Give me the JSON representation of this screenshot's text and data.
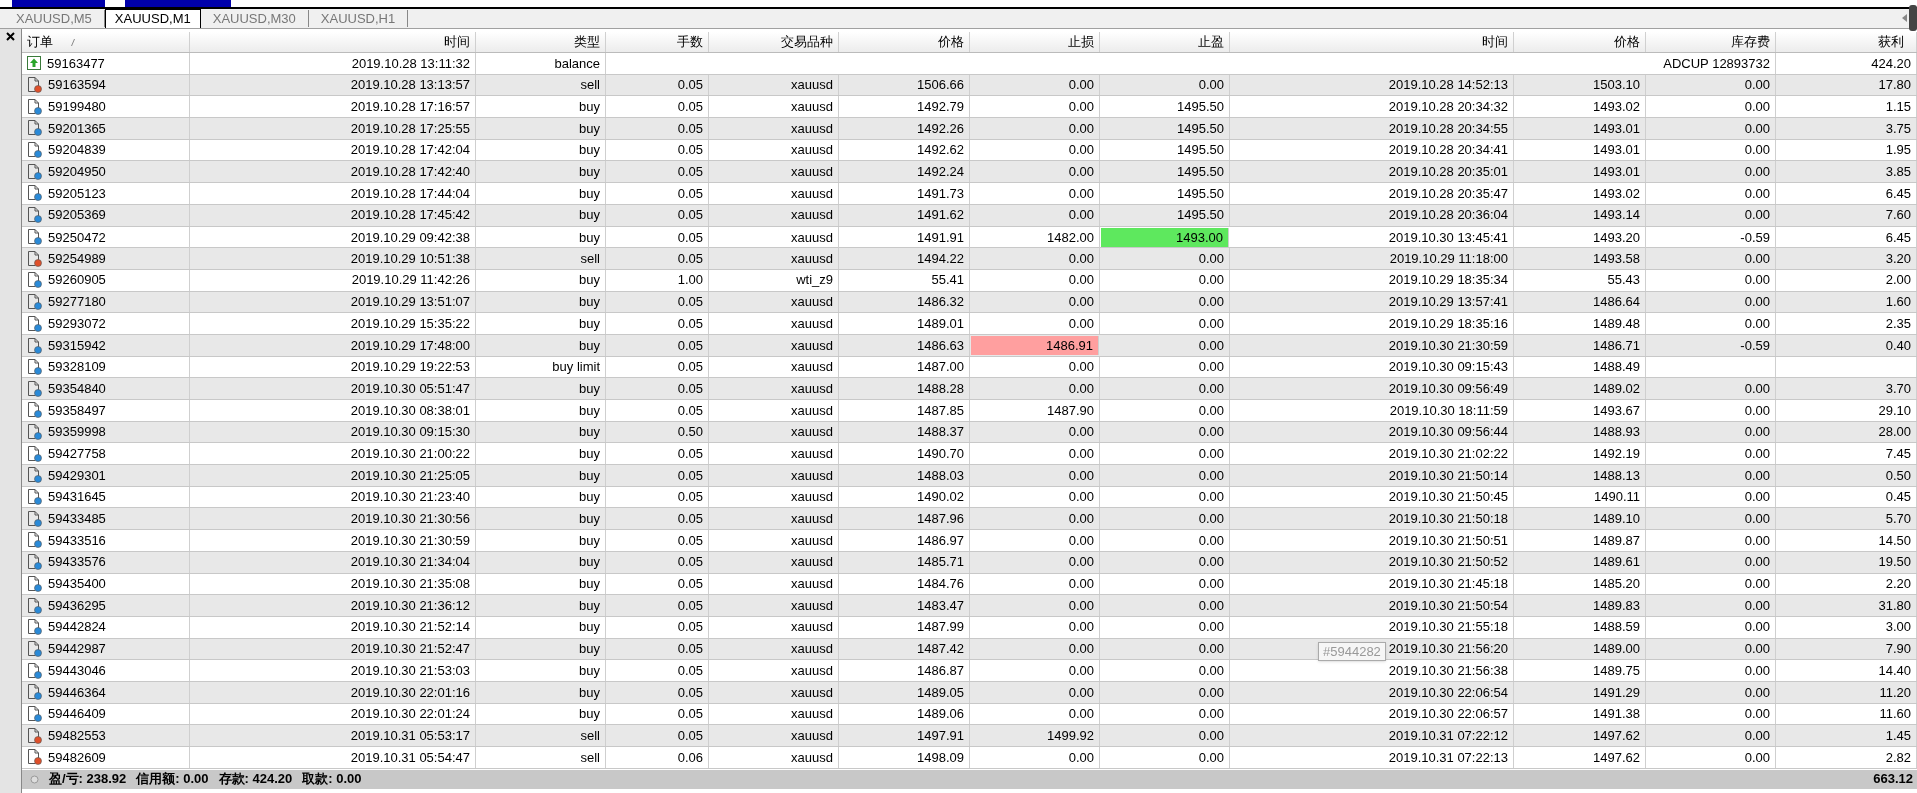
{
  "tabs": [
    {
      "label": "XAUUSD,M5",
      "selected": false
    },
    {
      "label": "XAUUSD,M1",
      "selected": true
    },
    {
      "label": "XAUUSD,M30",
      "selected": false
    },
    {
      "label": "XAUUSD,H1",
      "selected": false
    }
  ],
  "table": {
    "columns": [
      "订单",
      "时间",
      "类型",
      "手数",
      "交易品种",
      "价格",
      "止损",
      "止盈",
      "时间",
      "价格",
      "库存费",
      "获利"
    ],
    "rows": [
      {
        "kind": "balance",
        "order": "59163477",
        "time": "2019.10.28 13:11:32",
        "type": "balance",
        "comment": "ADCUP 12893732",
        "profit": "424.20"
      },
      {
        "kind": "sell",
        "order": "59163594",
        "time": "2019.10.28 13:13:57",
        "type": "sell",
        "volume": "0.05",
        "symbol": "xauusd",
        "price": "1506.66",
        "sl": "0.00",
        "tp": "0.00",
        "sl_hit": false,
        "tp_hit": false,
        "close_time": "2019.10.28 14:52:13",
        "close_price": "1503.10",
        "swap": "0.00",
        "profit": "17.80"
      },
      {
        "kind": "buy",
        "order": "59199480",
        "time": "2019.10.28 17:16:57",
        "type": "buy",
        "volume": "0.05",
        "symbol": "xauusd",
        "price": "1492.79",
        "sl": "0.00",
        "tp": "1495.50",
        "sl_hit": false,
        "tp_hit": false,
        "close_time": "2019.10.28 20:34:32",
        "close_price": "1493.02",
        "swap": "0.00",
        "profit": "1.15"
      },
      {
        "kind": "buy",
        "order": "59201365",
        "time": "2019.10.28 17:25:55",
        "type": "buy",
        "volume": "0.05",
        "symbol": "xauusd",
        "price": "1492.26",
        "sl": "0.00",
        "tp": "1495.50",
        "sl_hit": false,
        "tp_hit": false,
        "close_time": "2019.10.28 20:34:55",
        "close_price": "1493.01",
        "swap": "0.00",
        "profit": "3.75"
      },
      {
        "kind": "buy",
        "order": "59204839",
        "time": "2019.10.28 17:42:04",
        "type": "buy",
        "volume": "0.05",
        "symbol": "xauusd",
        "price": "1492.62",
        "sl": "0.00",
        "tp": "1495.50",
        "sl_hit": false,
        "tp_hit": false,
        "close_time": "2019.10.28 20:34:41",
        "close_price": "1493.01",
        "swap": "0.00",
        "profit": "1.95"
      },
      {
        "kind": "buy",
        "order": "59204950",
        "time": "2019.10.28 17:42:40",
        "type": "buy",
        "volume": "0.05",
        "symbol": "xauusd",
        "price": "1492.24",
        "sl": "0.00",
        "tp": "1495.50",
        "sl_hit": false,
        "tp_hit": false,
        "close_time": "2019.10.28 20:35:01",
        "close_price": "1493.01",
        "swap": "0.00",
        "profit": "3.85"
      },
      {
        "kind": "buy",
        "order": "59205123",
        "time": "2019.10.28 17:44:04",
        "type": "buy",
        "volume": "0.05",
        "symbol": "xauusd",
        "price": "1491.73",
        "sl": "0.00",
        "tp": "1495.50",
        "sl_hit": false,
        "tp_hit": false,
        "close_time": "2019.10.28 20:35:47",
        "close_price": "1493.02",
        "swap": "0.00",
        "profit": "6.45"
      },
      {
        "kind": "buy",
        "order": "59205369",
        "time": "2019.10.28 17:45:42",
        "type": "buy",
        "volume": "0.05",
        "symbol": "xauusd",
        "price": "1491.62",
        "sl": "0.00",
        "tp": "1495.50",
        "sl_hit": false,
        "tp_hit": false,
        "close_time": "2019.10.28 20:36:04",
        "close_price": "1493.14",
        "swap": "0.00",
        "profit": "7.60"
      },
      {
        "kind": "buy",
        "order": "59250472",
        "time": "2019.10.29 09:42:38",
        "type": "buy",
        "volume": "0.05",
        "symbol": "xauusd",
        "price": "1491.91",
        "sl": "1482.00",
        "tp": "1493.00",
        "sl_hit": false,
        "tp_hit": true,
        "close_time": "2019.10.30 13:45:41",
        "close_price": "1493.20",
        "swap": "-0.59",
        "profit": "6.45"
      },
      {
        "kind": "sell",
        "order": "59254989",
        "time": "2019.10.29 10:51:38",
        "type": "sell",
        "volume": "0.05",
        "symbol": "xauusd",
        "price": "1494.22",
        "sl": "0.00",
        "tp": "0.00",
        "sl_hit": false,
        "tp_hit": false,
        "close_time": "2019.10.29 11:18:00",
        "close_price": "1493.58",
        "swap": "0.00",
        "profit": "3.20"
      },
      {
        "kind": "buy",
        "order": "59260905",
        "time": "2019.10.29 11:42:26",
        "type": "buy",
        "volume": "1.00",
        "symbol": "wti_z9",
        "price": "55.41",
        "sl": "0.00",
        "tp": "0.00",
        "sl_hit": false,
        "tp_hit": false,
        "close_time": "2019.10.29 18:35:34",
        "close_price": "55.43",
        "swap": "0.00",
        "profit": "2.00"
      },
      {
        "kind": "buy",
        "order": "59277180",
        "time": "2019.10.29 13:51:07",
        "type": "buy",
        "volume": "0.05",
        "symbol": "xauusd",
        "price": "1486.32",
        "sl": "0.00",
        "tp": "0.00",
        "sl_hit": false,
        "tp_hit": false,
        "close_time": "2019.10.29 13:57:41",
        "close_price": "1486.64",
        "swap": "0.00",
        "profit": "1.60"
      },
      {
        "kind": "buy",
        "order": "59293072",
        "time": "2019.10.29 15:35:22",
        "type": "buy",
        "volume": "0.05",
        "symbol": "xauusd",
        "price": "1489.01",
        "sl": "0.00",
        "tp": "0.00",
        "sl_hit": false,
        "tp_hit": false,
        "close_time": "2019.10.29 18:35:16",
        "close_price": "1489.48",
        "swap": "0.00",
        "profit": "2.35"
      },
      {
        "kind": "buy",
        "order": "59315942",
        "time": "2019.10.29 17:48:00",
        "type": "buy",
        "volume": "0.05",
        "symbol": "xauusd",
        "price": "1486.63",
        "sl": "1486.91",
        "tp": "0.00",
        "sl_hit": true,
        "tp_hit": false,
        "close_time": "2019.10.30 21:30:59",
        "close_price": "1486.71",
        "swap": "-0.59",
        "profit": "0.40"
      },
      {
        "kind": "buy",
        "order": "59328109",
        "time": "2019.10.29 19:22:53",
        "type": "buy limit",
        "volume": "0.05",
        "symbol": "xauusd",
        "price": "1487.00",
        "sl": "0.00",
        "tp": "0.00",
        "sl_hit": false,
        "tp_hit": false,
        "close_time": "2019.10.30 09:15:43",
        "close_price": "1488.49"
      },
      {
        "kind": "buy",
        "order": "59354840",
        "time": "2019.10.30 05:51:47",
        "type": "buy",
        "volume": "0.05",
        "symbol": "xauusd",
        "price": "1488.28",
        "sl": "0.00",
        "tp": "0.00",
        "sl_hit": false,
        "tp_hit": false,
        "close_time": "2019.10.30 09:56:49",
        "close_price": "1489.02",
        "swap": "0.00",
        "profit": "3.70"
      },
      {
        "kind": "buy",
        "order": "59358497",
        "time": "2019.10.30 08:38:01",
        "type": "buy",
        "volume": "0.05",
        "symbol": "xauusd",
        "price": "1487.85",
        "sl": "1487.90",
        "tp": "0.00",
        "sl_hit": false,
        "tp_hit": false,
        "close_time": "2019.10.30 18:11:59",
        "close_price": "1493.67",
        "swap": "0.00",
        "profit": "29.10"
      },
      {
        "kind": "buy",
        "order": "59359998",
        "time": "2019.10.30 09:15:30",
        "type": "buy",
        "volume": "0.50",
        "symbol": "xauusd",
        "price": "1488.37",
        "sl": "0.00",
        "tp": "0.00",
        "sl_hit": false,
        "tp_hit": false,
        "close_time": "2019.10.30 09:56:44",
        "close_price": "1488.93",
        "swap": "0.00",
        "profit": "28.00"
      },
      {
        "kind": "buy",
        "order": "59427758",
        "time": "2019.10.30 21:00:22",
        "type": "buy",
        "volume": "0.05",
        "symbol": "xauusd",
        "price": "1490.70",
        "sl": "0.00",
        "tp": "0.00",
        "sl_hit": false,
        "tp_hit": false,
        "close_time": "2019.10.30 21:02:22",
        "close_price": "1492.19",
        "swap": "0.00",
        "profit": "7.45"
      },
      {
        "kind": "buy",
        "order": "59429301",
        "time": "2019.10.30 21:25:05",
        "type": "buy",
        "volume": "0.05",
        "symbol": "xauusd",
        "price": "1488.03",
        "sl": "0.00",
        "tp": "0.00",
        "sl_hit": false,
        "tp_hit": false,
        "close_time": "2019.10.30 21:50:14",
        "close_price": "1488.13",
        "swap": "0.00",
        "profit": "0.50"
      },
      {
        "kind": "buy",
        "order": "59431645",
        "time": "2019.10.30 21:23:40",
        "type": "buy",
        "volume": "0.05",
        "symbol": "xauusd",
        "price": "1490.02",
        "sl": "0.00",
        "tp": "0.00",
        "sl_hit": false,
        "tp_hit": false,
        "close_time": "2019.10.30 21:50:45",
        "close_price": "1490.11",
        "swap": "0.00",
        "profit": "0.45"
      },
      {
        "kind": "buy",
        "order": "59433485",
        "time": "2019.10.30 21:30:56",
        "type": "buy",
        "volume": "0.05",
        "symbol": "xauusd",
        "price": "1487.96",
        "sl": "0.00",
        "tp": "0.00",
        "sl_hit": false,
        "tp_hit": false,
        "close_time": "2019.10.30 21:50:18",
        "close_price": "1489.10",
        "swap": "0.00",
        "profit": "5.70"
      },
      {
        "kind": "buy",
        "order": "59433516",
        "time": "2019.10.30 21:30:59",
        "type": "buy",
        "volume": "0.05",
        "symbol": "xauusd",
        "price": "1486.97",
        "sl": "0.00",
        "tp": "0.00",
        "sl_hit": false,
        "tp_hit": false,
        "close_time": "2019.10.30 21:50:51",
        "close_price": "1489.87",
        "swap": "0.00",
        "profit": "14.50"
      },
      {
        "kind": "buy",
        "order": "59433576",
        "time": "2019.10.30 21:34:04",
        "type": "buy",
        "volume": "0.05",
        "symbol": "xauusd",
        "price": "1485.71",
        "sl": "0.00",
        "tp": "0.00",
        "sl_hit": false,
        "tp_hit": false,
        "close_time": "2019.10.30 21:50:52",
        "close_price": "1489.61",
        "swap": "0.00",
        "profit": "19.50"
      },
      {
        "kind": "buy",
        "order": "59435400",
        "time": "2019.10.30 21:35:08",
        "type": "buy",
        "volume": "0.05",
        "symbol": "xauusd",
        "price": "1484.76",
        "sl": "0.00",
        "tp": "0.00",
        "sl_hit": false,
        "tp_hit": false,
        "close_time": "2019.10.30 21:45:18",
        "close_price": "1485.20",
        "swap": "0.00",
        "profit": "2.20"
      },
      {
        "kind": "buy",
        "order": "59436295",
        "time": "2019.10.30 21:36:12",
        "type": "buy",
        "volume": "0.05",
        "symbol": "xauusd",
        "price": "1483.47",
        "sl": "0.00",
        "tp": "0.00",
        "sl_hit": false,
        "tp_hit": false,
        "close_time": "2019.10.30 21:50:54",
        "close_price": "1489.83",
        "swap": "0.00",
        "profit": "31.80"
      },
      {
        "kind": "buy",
        "order": "59442824",
        "time": "2019.10.30 21:52:14",
        "type": "buy",
        "volume": "0.05",
        "symbol": "xauusd",
        "price": "1487.99",
        "sl": "0.00",
        "tp": "0.00",
        "sl_hit": false,
        "tp_hit": false,
        "close_time": "2019.10.30 21:55:18",
        "close_price": "1488.59",
        "swap": "0.00",
        "profit": "3.00"
      },
      {
        "kind": "buy",
        "order": "59442987",
        "time": "2019.10.30 21:52:47",
        "type": "buy",
        "volume": "0.05",
        "symbol": "xauusd",
        "price": "1487.42",
        "sl": "0.00",
        "tp": "0.00",
        "sl_hit": false,
        "tp_hit": false,
        "close_time": "2019.10.30 21:56:20",
        "close_price": "1489.00",
        "swap": "0.00",
        "profit": "7.90"
      },
      {
        "kind": "buy",
        "order": "59443046",
        "time": "2019.10.30 21:53:03",
        "type": "buy",
        "volume": "0.05",
        "symbol": "xauusd",
        "price": "1486.87",
        "sl": "0.00",
        "tp": "0.00",
        "sl_hit": false,
        "tp_hit": false,
        "close_time": "2019.10.30 21:56:38",
        "close_price": "1489.75",
        "swap": "0.00",
        "profit": "14.40"
      },
      {
        "kind": "buy",
        "order": "59446364",
        "time": "2019.10.30 22:01:16",
        "type": "buy",
        "volume": "0.05",
        "symbol": "xauusd",
        "price": "1489.05",
        "sl": "0.00",
        "tp": "0.00",
        "sl_hit": false,
        "tp_hit": false,
        "close_time": "2019.10.30 22:06:54",
        "close_price": "1491.29",
        "swap": "0.00",
        "profit": "11.20"
      },
      {
        "kind": "buy",
        "order": "59446409",
        "time": "2019.10.30 22:01:24",
        "type": "buy",
        "volume": "0.05",
        "symbol": "xauusd",
        "price": "1489.06",
        "sl": "0.00",
        "tp": "0.00",
        "sl_hit": false,
        "tp_hit": false,
        "close_time": "2019.10.30 22:06:57",
        "close_price": "1491.38",
        "swap": "0.00",
        "profit": "11.60"
      },
      {
        "kind": "sell",
        "order": "59482553",
        "time": "2019.10.31 05:53:17",
        "type": "sell",
        "volume": "0.05",
        "symbol": "xauusd",
        "price": "1497.91",
        "sl": "1499.92",
        "tp": "0.00",
        "sl_hit": false,
        "tp_hit": false,
        "close_time": "2019.10.31 07:22:12",
        "close_price": "1497.62",
        "swap": "0.00",
        "profit": "1.45"
      },
      {
        "kind": "sell",
        "order": "59482609",
        "time": "2019.10.31 05:54:47",
        "type": "sell",
        "volume": "0.06",
        "symbol": "xauusd",
        "price": "1498.09",
        "sl": "0.00",
        "tp": "0.00",
        "sl_hit": false,
        "tp_hit": false,
        "close_time": "2019.10.31 07:22:13",
        "close_price": "1497.62",
        "swap": "0.00",
        "profit": "2.82"
      }
    ]
  },
  "tooltip": {
    "text": "#5944282"
  },
  "summary": {
    "items": [
      {
        "label": "盈/亏:",
        "value": "238.92"
      },
      {
        "label": "信用额:",
        "value": "0.00"
      },
      {
        "label": "存款:",
        "value": "424.20"
      },
      {
        "label": "取款:",
        "value": "0.00"
      }
    ],
    "total": "663.12"
  }
}
